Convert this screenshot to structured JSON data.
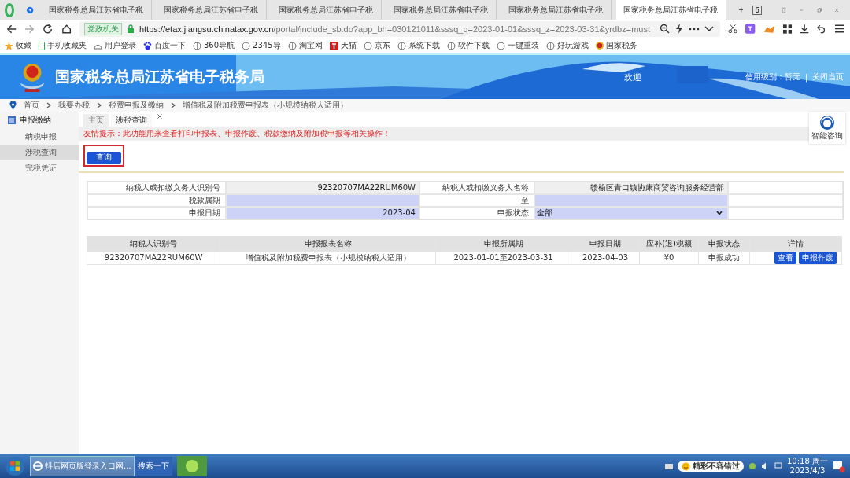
{
  "browser": {
    "tabs": [
      {
        "title": "国家税务总局江苏省电子税",
        "selected": false
      },
      {
        "title": "国家税务总局江苏省电子税",
        "selected": false
      },
      {
        "title": "国家税务总局江苏省电子税",
        "selected": false
      },
      {
        "title": "国家税务总局江苏省电子税",
        "selected": false
      },
      {
        "title": "国家税务总局江苏省电子税",
        "selected": false
      },
      {
        "title": "国家税务总局江苏省电子税",
        "selected": true
      }
    ],
    "tab_count": "6",
    "site_badge": "党政机关",
    "url_host": "https://etax.jiangsu.chinatax.gov.cn",
    "url_rest": "/portal/include_sb.do?app_bh=030121011&sssq_q=2023-01-01&sssq_z=2023-03-31&yrdbz=must",
    "bookmarks": [
      {
        "label": "收藏",
        "kind": "star"
      },
      {
        "label": "手机收藏夹",
        "kind": "phone"
      },
      {
        "label": "用户登录",
        "kind": "user"
      },
      {
        "label": "百度一下",
        "kind": "paw"
      },
      {
        "label": "360导航",
        "kind": "globe"
      },
      {
        "label": "2345导",
        "kind": "globe"
      },
      {
        "label": "淘宝网",
        "kind": "globe"
      },
      {
        "label": "天猫",
        "kind": "tmall"
      },
      {
        "label": "京东",
        "kind": "globe"
      },
      {
        "label": "系统下载",
        "kind": "globe"
      },
      {
        "label": "软件下载",
        "kind": "globe"
      },
      {
        "label": "一键重装",
        "kind": "globe"
      },
      {
        "label": "好玩游戏",
        "kind": "globe"
      },
      {
        "label": "国家税务",
        "kind": "emblem"
      }
    ]
  },
  "header": {
    "title": "国家税务总局江苏省电子税务局",
    "welcome": "欢迎",
    "credit": "信用级别：暂无",
    "separator": "|",
    "close": "关闭当页"
  },
  "breadcrumb": [
    "首页",
    "我要办税",
    "税费申报及缴纳",
    "增值税及附加税费申报表（小规模纳税人适用）"
  ],
  "sidebar": {
    "title": "申报缴纳",
    "items": [
      {
        "label": "纳税申报",
        "selected": false
      },
      {
        "label": "涉税查询",
        "selected": true
      },
      {
        "label": "完税凭证",
        "selected": false
      }
    ]
  },
  "page_tabs": [
    {
      "label": "主页",
      "selected": false,
      "closable": false
    },
    {
      "label": "涉税查询",
      "selected": true,
      "closable": true
    }
  ],
  "notice": "友情提示：此功能用来查看打印申报表、申报作废、税款缴纳及附加税申报等相关操作！",
  "query_button": "查询",
  "help": "智能咨询",
  "form": {
    "taxpayer_id_label": "纳税人或扣缴义务人识别号",
    "taxpayer_id": "92320707MA22RUM60W",
    "taxpayer_name_label": "纳税人或扣缴义务人名称",
    "taxpayer_name": "赣榆区青口镇协康商贸咨询服务经营部",
    "period_label": "税款属期",
    "period_to": "至",
    "date_label": "申报日期",
    "date": "2023-04",
    "status_label": "申报状态",
    "status": "全部"
  },
  "table": {
    "columns": [
      "纳税人识别号",
      "申报报表名称",
      "申报所属期",
      "申报日期",
      "应补(退)税额",
      "申报状态",
      "详情"
    ],
    "rows": [
      {
        "cells": [
          "92320707MA22RUM60W",
          "增值税及附加税费申报表（小规模纳税人适用）",
          "2023-01-01至2023-03-31",
          "2023-04-03",
          "¥0",
          "申报成功"
        ],
        "actions": [
          "查看",
          "申报作废"
        ]
      }
    ]
  },
  "taskbar": {
    "window": "抖店网页版登录入口网...",
    "search": "搜索一下",
    "tray_banner": "精彩不容错过",
    "time": "10:18 周一",
    "date": "2023/4/3"
  }
}
